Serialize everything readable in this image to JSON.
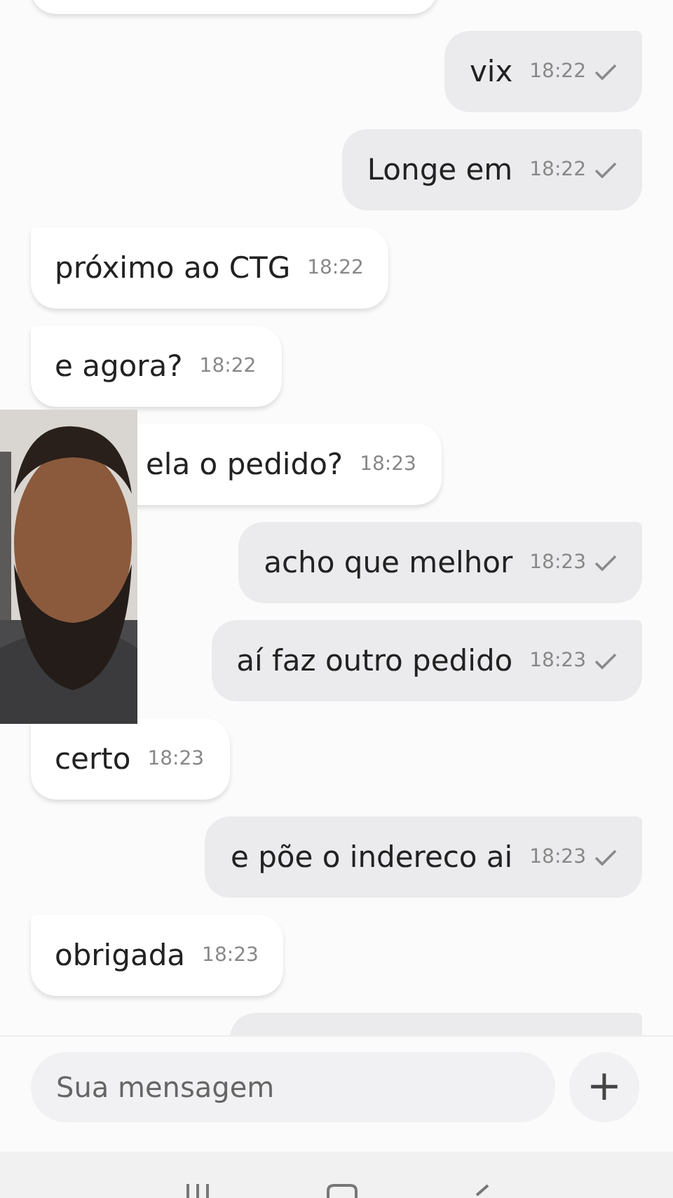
{
  "messages": [
    {
      "text": "vix",
      "time": "18:22",
      "outgoing": true,
      "sent": true,
      "partly_hidden": false
    },
    {
      "text": "Longe em",
      "time": "18:22",
      "outgoing": true,
      "sent": true,
      "partly_hidden": false
    },
    {
      "text": "próximo ao CTG",
      "time": "18:22",
      "outgoing": false,
      "sent": false,
      "partly_hidden": false
    },
    {
      "text": "e agora?",
      "time": "18:22",
      "outgoing": false,
      "sent": false,
      "partly_hidden": false
    },
    {
      "text": "ela o pedido?",
      "time": "18:23",
      "outgoing": false,
      "sent": false,
      "partly_hidden": true
    },
    {
      "text": "acho que melhor",
      "time": "18:23",
      "outgoing": true,
      "sent": true,
      "partly_hidden": false
    },
    {
      "text": "aí faz outro pedido",
      "time": "18:23",
      "outgoing": true,
      "sent": true,
      "partly_hidden": false
    },
    {
      "text": "certo",
      "time": "18:23",
      "outgoing": false,
      "sent": false,
      "partly_hidden": false
    },
    {
      "text": "e põe o indereco ai",
      "time": "18:23",
      "outgoing": true,
      "sent": true,
      "partly_hidden": false
    },
    {
      "text": "obrigada",
      "time": "18:23",
      "outgoing": false,
      "sent": false,
      "partly_hidden": false
    }
  ],
  "composer": {
    "placeholder": "Sua mensagem",
    "button": "+"
  }
}
